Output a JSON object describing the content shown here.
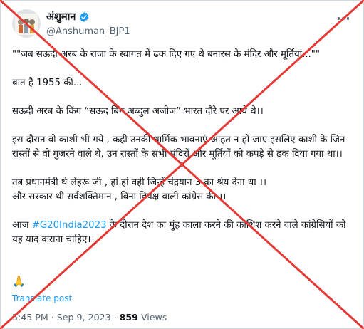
{
  "author": {
    "display_name": "अंशुमान",
    "handle": "@Anshuman_BJP1",
    "verified": true,
    "verified_color": "#1d9bf0"
  },
  "tweet": {
    "paragraphs": [
      "\"\"जब सऊदी अरब के राजा के स्वागत में ढक दिए गए थे बनारस के मंदिर और मूर्तियां...\"\"",
      "बात है 1955 की...",
      "सऊदी अरब के किंग “सऊद बिन अब्दुल अजीज” भारत दौरे पर आये थे।।",
      "इस दौरान वो काशी भी गये , कही उनकी धार्मिक भावनाएं आहत न हों जाए इसलिए काशी के जिन रास्तों से वो गुज़रने वाले थे, उन रास्तों के सभी मंदिरों और मूर्तियों को कपड़े से ढक दिया गया था।।",
      "तब प्रधानमंत्री थे लेहरू जी , हां हां वही जिन्हें चंद्रयान 3 का श्रेय देना था ।।",
      "और सरकार थी सर्वशक्तिमान , बिना विपक्ष वाली कांग्रेस की ।।"
    ],
    "last_para_prefix": "आज ",
    "hashtag": "#G20India2023",
    "last_para_suffix": " के दौरान देश का मुंह काला करने की कोशिश करने वाले कांग्रेसियों को यह याद कराना चाहिए।।",
    "emoji": "🙏",
    "translate_label": "Translate post",
    "time": "5:45 PM",
    "separator": "·",
    "date": "Sep 9, 2023",
    "views_count": "859",
    "views_label": "Views"
  },
  "colors": {
    "accent": "#1d9bf0",
    "cross_line": "#e53935",
    "secondary_text": "#536471"
  }
}
